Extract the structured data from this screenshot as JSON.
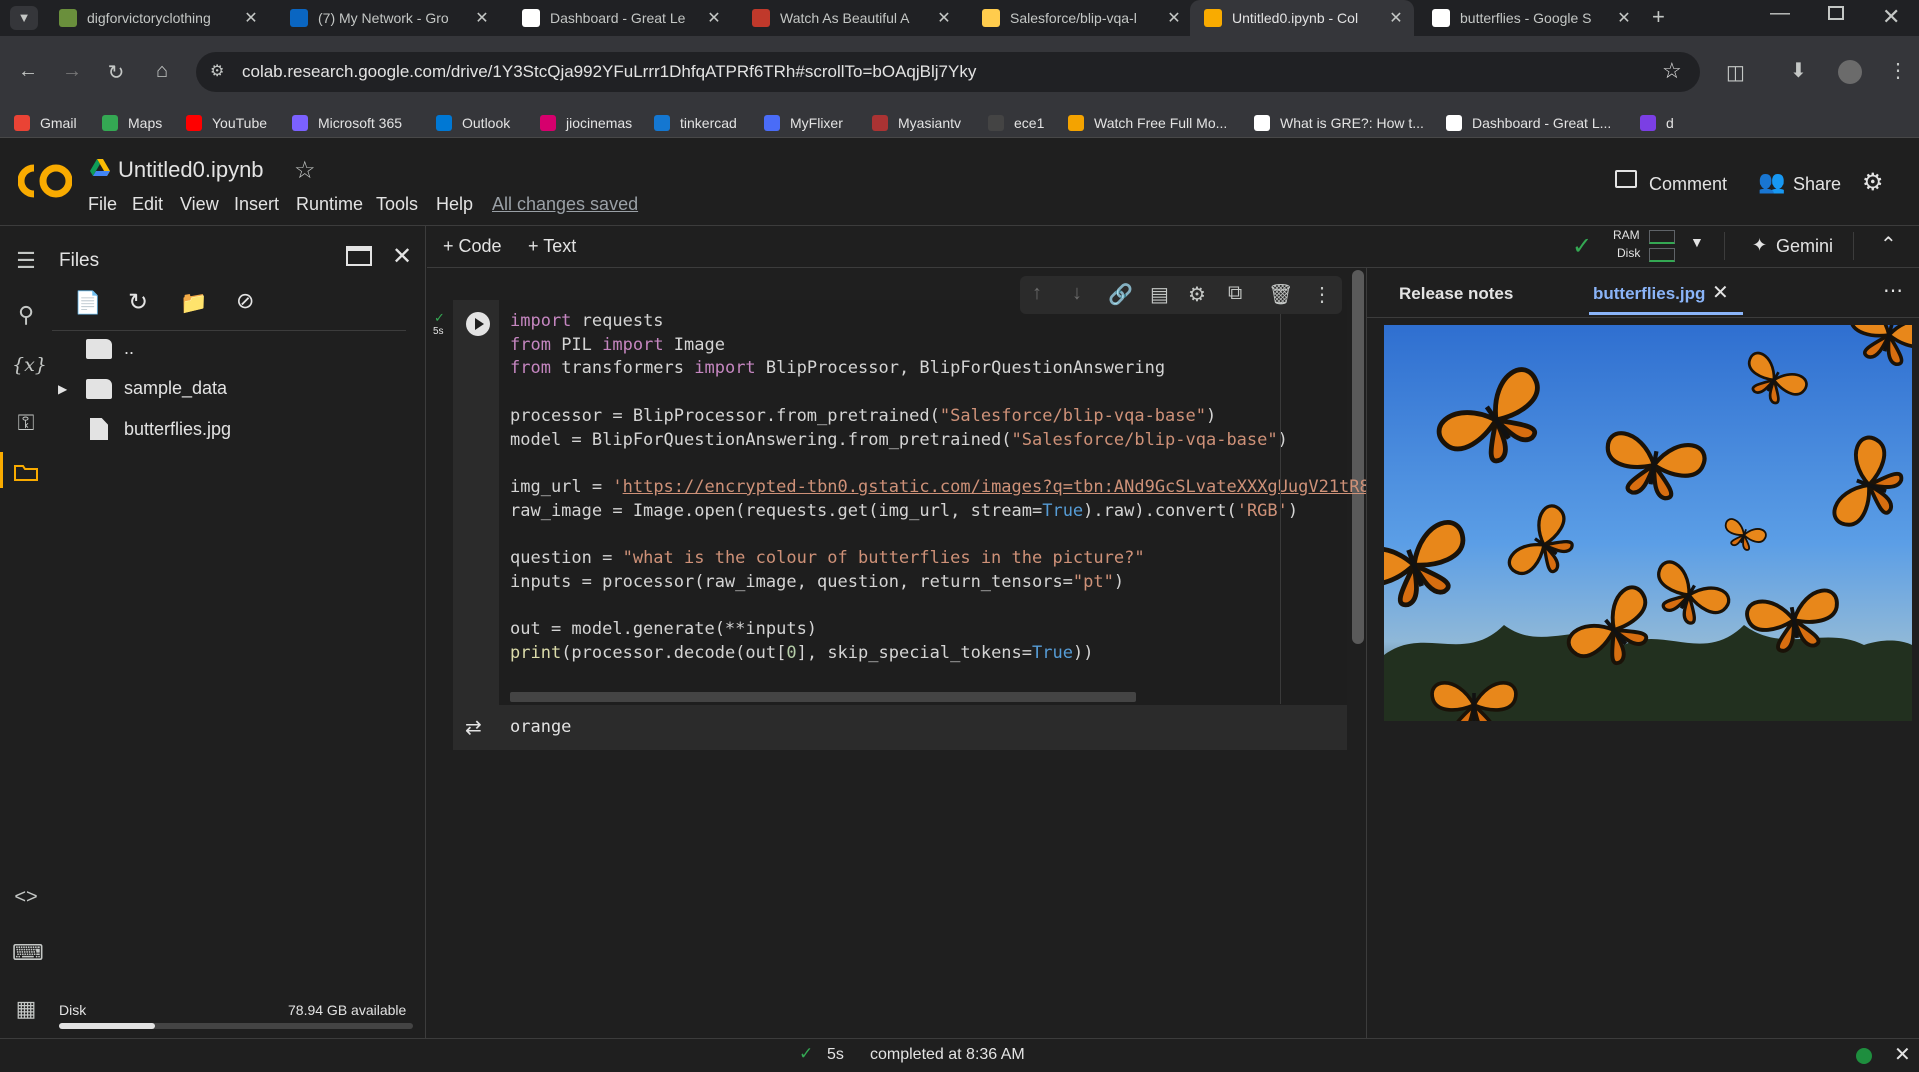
{
  "browser": {
    "tabs": [
      {
        "title": "digforvictoryclothing",
        "icon": "site-favicon",
        "color": "#6a8f3c"
      },
      {
        "title": "(7) My Network - Gro",
        "icon": "linkedin-icon",
        "color": "#0a66c2"
      },
      {
        "title": "Dashboard - Great Le",
        "icon": "google-icon",
        "color": "#ffffff"
      },
      {
        "title": "Watch As Beautiful A",
        "icon": "site-favicon",
        "color": "#c0392b"
      },
      {
        "title": "Salesforce/blip-vqa-l",
        "icon": "huggingface-icon",
        "color": "#ffcc4d"
      },
      {
        "title": "Untitled0.ipynb - Col",
        "icon": "colab-icon",
        "color": "#f9ab00"
      },
      {
        "title": "butterflies - Google S",
        "icon": "google-icon",
        "color": "#ffffff"
      }
    ],
    "url": "colab.research.google.com/drive/1Y3StcQja992YFuLrrr1DhfqATPRf6TRh#scrollTo=bOAqjBlj7Yky",
    "bookmarks": [
      {
        "label": "Gmail",
        "color": "#ea4335"
      },
      {
        "label": "Maps",
        "color": "#34a853"
      },
      {
        "label": "YouTube",
        "color": "#ff0000"
      },
      {
        "label": "Microsoft 365",
        "color": "#7b61ff"
      },
      {
        "label": "Outlook",
        "color": "#0078d4"
      },
      {
        "label": "jiocinemas",
        "color": "#d6006d"
      },
      {
        "label": "tinkercad",
        "color": "#1477d1"
      },
      {
        "label": "MyFlixer",
        "color": "#4a6cf7"
      },
      {
        "label": "Myasiantv",
        "color": "#aa3333"
      },
      {
        "label": "ece1",
        "color": "#444444"
      },
      {
        "label": "Watch Free Full Mo...",
        "color": "#f4a300"
      },
      {
        "label": "What is GRE?: How t...",
        "color": "#ffffff"
      },
      {
        "label": "Dashboard - Great L...",
        "color": "#ffffff"
      },
      {
        "label": "d",
        "color": "#7b3fe4"
      }
    ]
  },
  "colab": {
    "notebook_title": "Untitled0.ipynb",
    "menu": [
      "File",
      "Edit",
      "View",
      "Insert",
      "Runtime",
      "Tools",
      "Help"
    ],
    "save_status": "All changes saved",
    "comment_label": "Comment",
    "share_label": "Share",
    "add_code_label": "+ Code",
    "add_text_label": "+ Text",
    "ram_label": "RAM",
    "disk_label": "Disk",
    "gemini_label": "Gemini"
  },
  "files_panel": {
    "title": "Files",
    "items": [
      {
        "name": "..",
        "type": "folder"
      },
      {
        "name": "sample_data",
        "type": "folder"
      },
      {
        "name": "butterflies.jpg",
        "type": "file"
      }
    ],
    "disk_label": "Disk",
    "disk_available": "78.94 GB available",
    "disk_used_fraction": 0.27
  },
  "cell": {
    "exec_time": "5s",
    "output": "orange"
  },
  "right_pane": {
    "tabs": [
      "Release notes",
      "butterflies.jpg"
    ],
    "active_tab": "butterflies.jpg"
  },
  "status": {
    "duration": "5s",
    "text": "completed at 8:36 AM"
  }
}
